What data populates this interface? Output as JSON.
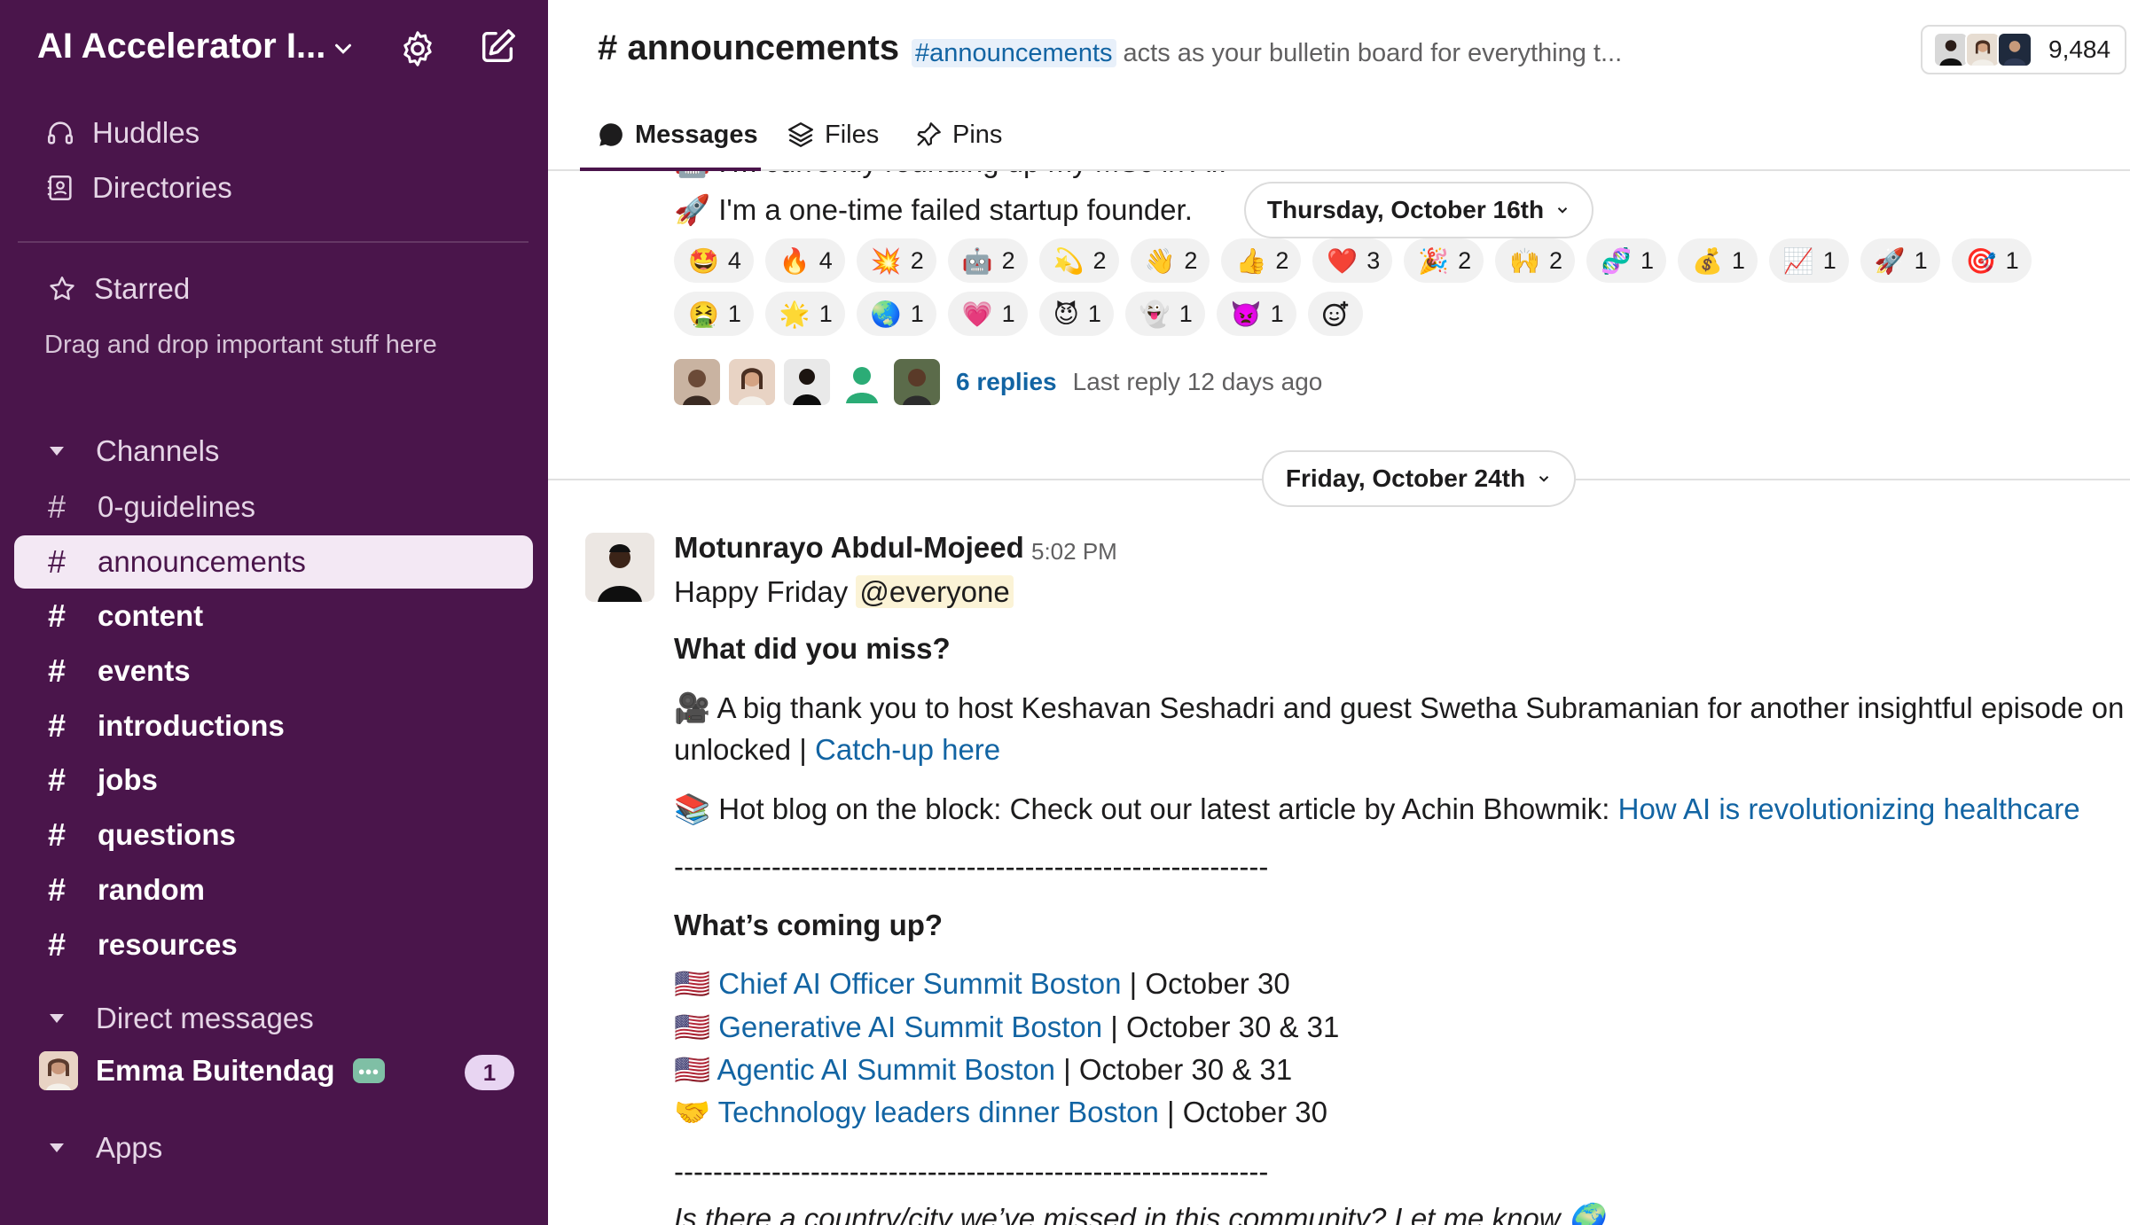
{
  "workspace": {
    "name": "AI Accelerator I...",
    "icons": [
      "chevron-down-icon",
      "gear-icon",
      "compose-icon"
    ]
  },
  "sidebar": {
    "nav": [
      {
        "label": "Huddles",
        "icon": "headphones-icon"
      },
      {
        "label": "Directories",
        "icon": "directory-icon"
      }
    ],
    "starred": {
      "label": "Starred",
      "hint": "Drag and drop important stuff here"
    },
    "channels_header": "Channels",
    "channels": [
      {
        "name": "0-guidelines",
        "unread": false,
        "active": false
      },
      {
        "name": "announcements",
        "unread": false,
        "active": true
      },
      {
        "name": "content",
        "unread": true,
        "active": false
      },
      {
        "name": "events",
        "unread": true,
        "active": false
      },
      {
        "name": "introductions",
        "unread": true,
        "active": false
      },
      {
        "name": "jobs",
        "unread": true,
        "active": false
      },
      {
        "name": "questions",
        "unread": true,
        "active": false
      },
      {
        "name": "random",
        "unread": true,
        "active": false
      },
      {
        "name": "resources",
        "unread": true,
        "active": false
      }
    ],
    "dm_header": "Direct messages",
    "dm": {
      "name": "Emma Buitendag",
      "badge": "1"
    },
    "apps_header": "Apps"
  },
  "header": {
    "channel": "# announcements",
    "topic_link": "#announcements",
    "topic_rest": " acts as your bulletin board for everything t...",
    "member_count": "9,484"
  },
  "tabs": [
    {
      "label": "Messages",
      "icon": "message-icon"
    },
    {
      "label": "Files",
      "icon": "layers-icon"
    },
    {
      "label": "Pins",
      "icon": "pin-icon"
    }
  ],
  "prev_message": {
    "partial_line": "I'm currently rounding up my MSc in AI.",
    "line2_emoji": "🚀",
    "line2_text": "I'm a one-time failed startup founder.",
    "reactions_row1": [
      {
        "emoji": "🤩",
        "count": "4"
      },
      {
        "emoji": "🔥",
        "count": "4"
      },
      {
        "emoji": "💥",
        "count": "2"
      },
      {
        "emoji": "🤖",
        "count": "2"
      },
      {
        "emoji": "💫",
        "count": "2"
      },
      {
        "emoji": "👋",
        "count": "2"
      },
      {
        "emoji": "👍",
        "count": "2"
      },
      {
        "emoji": "❤️",
        "count": "3"
      },
      {
        "emoji": "🎉",
        "count": "2"
      },
      {
        "emoji": "🙌",
        "count": "2"
      },
      {
        "emoji": "🧬",
        "count": "1"
      },
      {
        "emoji": "💰",
        "count": "1"
      },
      {
        "emoji": "📈",
        "count": "1"
      },
      {
        "emoji": "🚀",
        "count": "1"
      },
      {
        "emoji": "🎯",
        "count": "1"
      }
    ],
    "reactions_row2": [
      {
        "emoji": "🤮",
        "count": "1"
      },
      {
        "emoji": "🌟",
        "count": "1"
      },
      {
        "emoji": "🌏",
        "count": "1"
      },
      {
        "emoji": "💗",
        "count": "1"
      },
      {
        "emoji": "😈",
        "count": "1"
      },
      {
        "emoji": "👻",
        "count": "1"
      },
      {
        "emoji": "👿",
        "count": "1"
      }
    ],
    "thread_replies": "6 replies",
    "thread_last": "Last reply 12 days ago"
  },
  "date_dividers": [
    "Thursday, October 16th",
    "Friday, October 24th"
  ],
  "message": {
    "author": "Motunrayo Abdul-Mojeed",
    "time": "5:02 PM",
    "greeting": "Happy Friday ",
    "mention": "@everyone",
    "h1": "What did you miss?",
    "p1_emoji": "🎥",
    "p1_text": "A big thank you to host Keshavan Seshadri and guest Swetha Subramanian for another insightful episode on AI",
    "p1_cont": "unlocked | ",
    "p1_link": "Catch-up here",
    "p2_emoji": "📚",
    "p2_text": " Hot blog on the block: Check out our latest article by Achin Bhowmik: ",
    "p2_link": "How AI is revolutionizing healthcare",
    "divider": "-------------------------------------------------------------",
    "h2": "What’s coming up?",
    "events": [
      {
        "emoji": "🇺🇸",
        "link": "Chief AI Officer Summit Boston",
        "date": " | October 30"
      },
      {
        "emoji": "🇺🇸",
        "link": "Generative AI Summit Boston",
        "date": " | October 30 & 31"
      },
      {
        "emoji": "🇺🇸",
        "link": "Agentic AI Summit Boston",
        "date": " | October 30 & 31"
      },
      {
        "emoji": "🤝",
        "link": "Technology leaders dinner Boston",
        "date": " | October 30"
      }
    ],
    "footer": "Is there a country/city we’ve missed in this community? Let me know",
    "footer_emoji": "🌍"
  },
  "colors": {
    "sidebar_bg": "#4a154b",
    "link": "#1264a3",
    "mention_bg": "#fbf3d6"
  }
}
